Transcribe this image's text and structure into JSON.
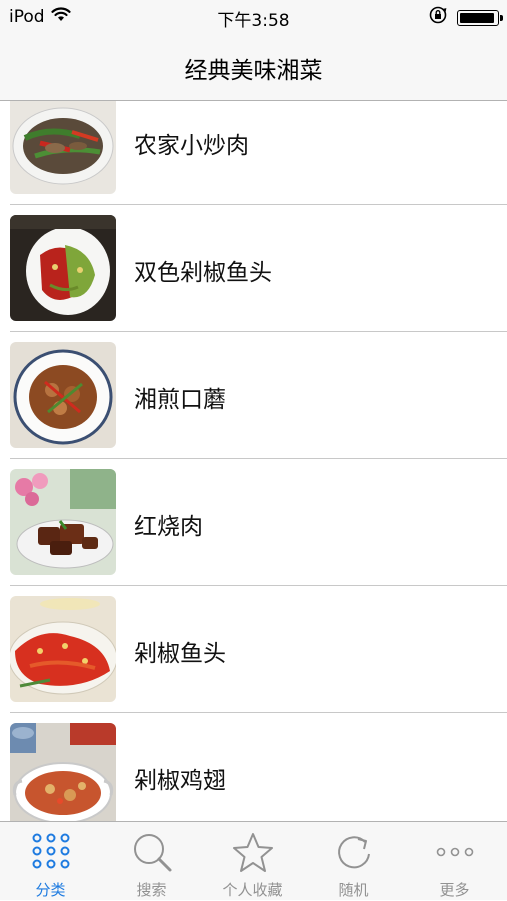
{
  "status": {
    "carrier": "iPod",
    "time": "下午3:58"
  },
  "nav": {
    "title": "经典美味湘菜"
  },
  "list": {
    "items": [
      {
        "label": "农家小炒肉"
      },
      {
        "label": "双色剁椒鱼头"
      },
      {
        "label": "湘煎口蘑"
      },
      {
        "label": "红烧肉"
      },
      {
        "label": "剁椒鱼头"
      },
      {
        "label": "剁椒鸡翅"
      }
    ]
  },
  "tabs": [
    {
      "label": "分类",
      "icon": "grid-icon",
      "active": true
    },
    {
      "label": "搜索",
      "icon": "search-icon"
    },
    {
      "label": "个人收藏",
      "icon": "star-icon"
    },
    {
      "label": "随机",
      "icon": "refresh-icon"
    },
    {
      "label": "更多",
      "icon": "more-icon"
    }
  ],
  "colors": {
    "accent": "#1e7be0",
    "inactive": "#929292",
    "bar": "#f7f7f7"
  }
}
